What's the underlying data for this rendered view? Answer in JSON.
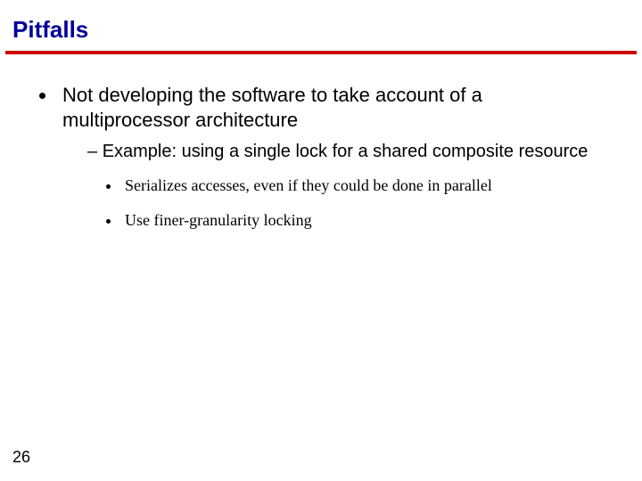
{
  "slide": {
    "title": "Pitfalls",
    "page_number": "26",
    "bullets": {
      "l1_0": "Not developing the software to take account of a multiprocessor architecture",
      "l2_0": "Example: using a single lock for a shared composite resource",
      "l3_0": "Serializes accesses, even if they could be done in parallel",
      "l3_1": "Use finer-granularity locking"
    }
  }
}
